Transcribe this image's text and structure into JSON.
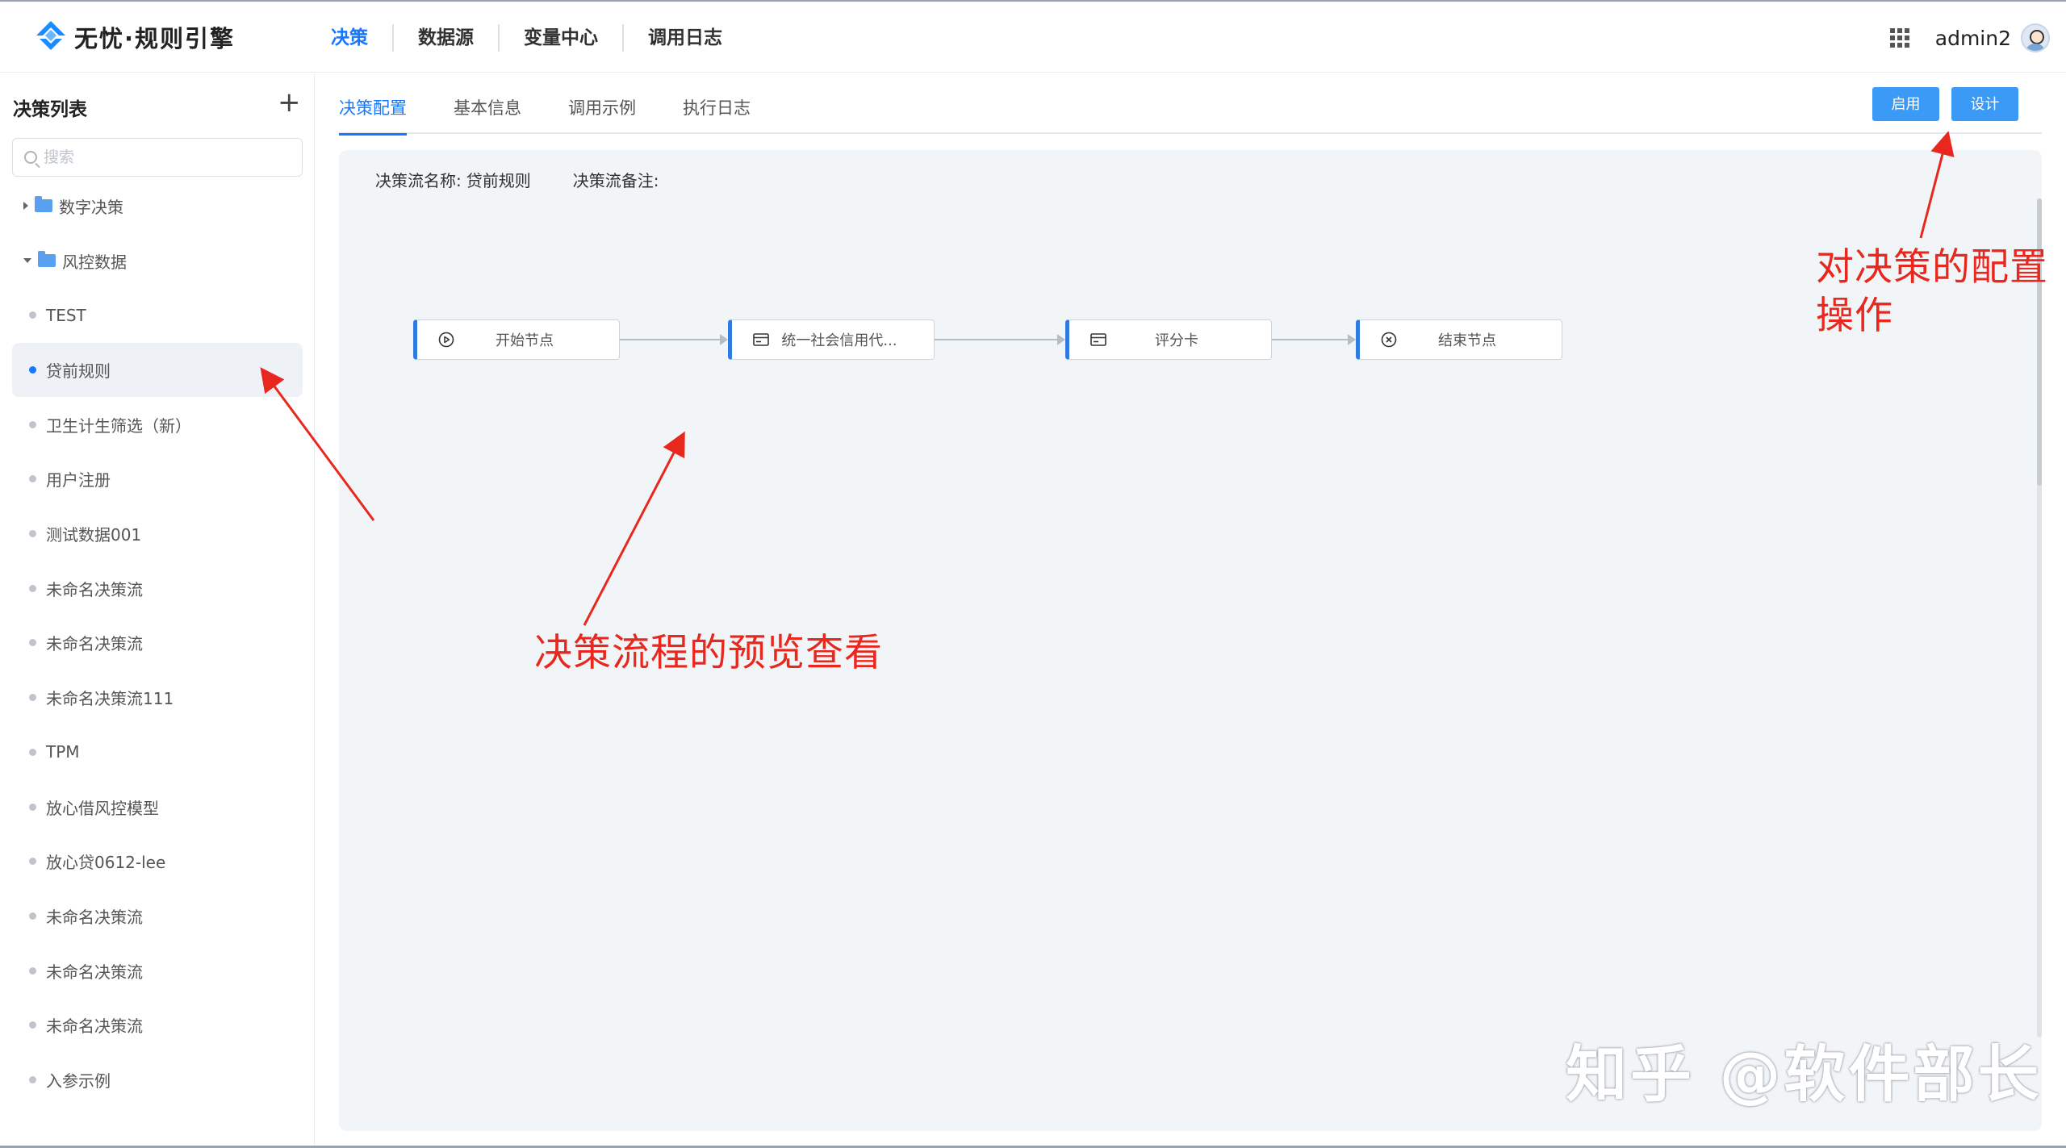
{
  "app": {
    "logo_text": "无忧·规则引擎"
  },
  "nav": {
    "items": [
      "决策",
      "数据源",
      "变量中心",
      "调用日志"
    ],
    "active_index": 0
  },
  "user": {
    "name": "admin2"
  },
  "sidebar": {
    "title": "决策列表",
    "add_label": "+",
    "search_placeholder": "搜索",
    "folders": [
      {
        "label": "数字决策",
        "expanded": false
      },
      {
        "label": "风控数据",
        "expanded": true
      }
    ],
    "items": [
      "TEST",
      "贷前规则",
      "卫生计生筛选（新）",
      "用户注册",
      "测试数据001",
      "未命名决策流",
      "未命名决策流",
      "未命名决策流111",
      "TPM",
      "放心借风控模型",
      "放心贷0612-lee",
      "未命名决策流",
      "未命名决策流",
      "未命名决策流",
      "入参示例"
    ],
    "active_index": 1
  },
  "tabs": {
    "items": [
      "决策配置",
      "基本信息",
      "调用示例",
      "执行日志"
    ],
    "active_index": 0
  },
  "actions": {
    "enable_label": "启用",
    "design_label": "设计"
  },
  "flow": {
    "name_label": "决策流名称:",
    "name_value": "贷前规则",
    "remark_label": "决策流备注:",
    "remark_value": "",
    "nodes": [
      {
        "label": "开始节点",
        "icon": "play-circle-icon"
      },
      {
        "label": "统一社会信用代...",
        "icon": "card-icon"
      },
      {
        "label": "评分卡",
        "icon": "card-icon"
      },
      {
        "label": "结束节点",
        "icon": "close-circle-icon"
      }
    ]
  },
  "annotations": {
    "config": [
      "对决策的配置",
      "操作"
    ],
    "preview": "决策流程的预览查看"
  },
  "watermark": "知乎 @软件部长",
  "colors": {
    "primary": "#1677ff",
    "button": "#3a9af5",
    "annotation": "#e8281e",
    "canvas_bg": "#f2f5f8"
  }
}
